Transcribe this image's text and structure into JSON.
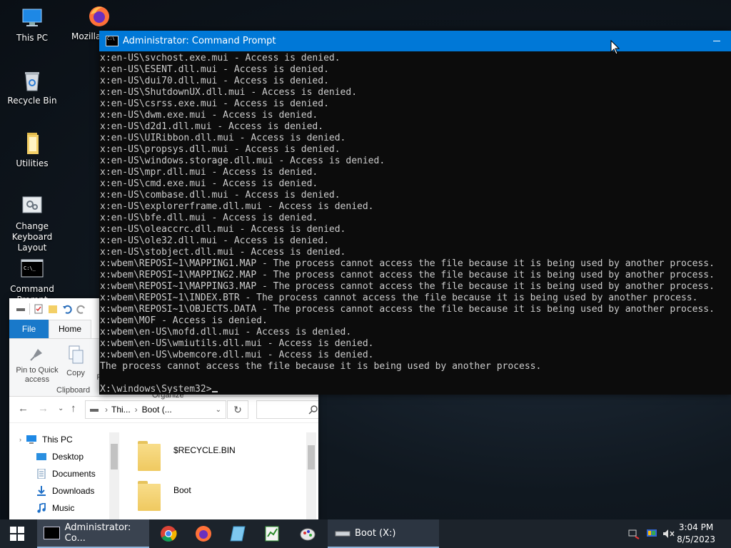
{
  "desktop": {
    "icons": [
      {
        "label": "This PC",
        "icon": "computer-icon"
      },
      {
        "label": "Mozilla",
        "icon": "firefox-icon"
      },
      {
        "label": "Recycle Bin",
        "icon": "recycle-bin-icon"
      },
      {
        "label": "Utilities",
        "icon": "folder-icon"
      },
      {
        "label": "Change Keyboard Layout",
        "icon": "keyboard-settings-icon"
      },
      {
        "label": "Command Prompt",
        "icon": "cmd-icon"
      }
    ]
  },
  "cmd": {
    "title": "Administrator: Command Prompt",
    "lines": [
      "x:en-US\\svchost.exe.mui - Access is denied.",
      "x:en-US\\ESENT.dll.mui - Access is denied.",
      "x:en-US\\dui70.dll.mui - Access is denied.",
      "x:en-US\\ShutdownUX.dll.mui - Access is denied.",
      "x:en-US\\csrss.exe.mui - Access is denied.",
      "x:en-US\\dwm.exe.mui - Access is denied.",
      "x:en-US\\d2d1.dll.mui - Access is denied.",
      "x:en-US\\UIRibbon.dll.mui - Access is denied.",
      "x:en-US\\propsys.dll.mui - Access is denied.",
      "x:en-US\\windows.storage.dll.mui - Access is denied.",
      "x:en-US\\mpr.dll.mui - Access is denied.",
      "x:en-US\\cmd.exe.mui - Access is denied.",
      "x:en-US\\combase.dll.mui - Access is denied.",
      "x:en-US\\explorerframe.dll.mui - Access is denied.",
      "x:en-US\\bfe.dll.mui - Access is denied.",
      "x:en-US\\oleaccrc.dll.mui - Access is denied.",
      "x:en-US\\ole32.dll.mui - Access is denied.",
      "x:en-US\\stobject.dll.mui - Access is denied.",
      "x:wbem\\REPOSI~1\\MAPPING1.MAP - The process cannot access the file because it is being used by another process.",
      "x:wbem\\REPOSI~1\\MAPPING2.MAP - The process cannot access the file because it is being used by another process.",
      "x:wbem\\REPOSI~1\\MAPPING3.MAP - The process cannot access the file because it is being used by another process.",
      "x:wbem\\REPOSI~1\\INDEX.BTR - The process cannot access the file because it is being used by another process.",
      "x:wbem\\REPOSI~1\\OBJECTS.DATA - The process cannot access the file because it is being used by another process.",
      "x:wbem\\MOF - Access is denied.",
      "x:wbem\\en-US\\mofd.dll.mui - Access is denied.",
      "x:wbem\\en-US\\wmiutils.dll.mui - Access is denied.",
      "x:wbem\\en-US\\wbemcore.dll.mui - Access is denied.",
      "The process cannot access the file because it is being used by another process."
    ],
    "prompt": "X:\\windows\\System32>"
  },
  "explorer": {
    "tabs": {
      "file": "File",
      "home": "Home"
    },
    "ribbon": {
      "pin_label": "Pin to Quick access",
      "copy_label": "Copy",
      "paste_partial": "P",
      "clipboard_group": "Clipboard",
      "organize_group": "Organize"
    },
    "address": {
      "seg1": "Thi...",
      "seg2": "Boot (..."
    },
    "nav_items": [
      {
        "label": "This PC",
        "icon": "computer-icon"
      },
      {
        "label": "Desktop",
        "icon": "desktop-folder-icon"
      },
      {
        "label": "Documents",
        "icon": "documents-icon"
      },
      {
        "label": "Downloads",
        "icon": "downloads-icon"
      },
      {
        "label": "Music",
        "icon": "music-icon"
      }
    ],
    "files": [
      {
        "name": "$RECYCLE.BIN"
      },
      {
        "name": "Boot"
      }
    ]
  },
  "taskbar": {
    "cmd_label": "Administrator: Co...",
    "explorer_label": "Boot (X:)",
    "clock_time": "3:04 PM",
    "clock_date": "8/5/2023"
  },
  "colors": {
    "titlebar": "#0078d7",
    "file_tab": "#1979ca",
    "taskbar": "#1c232b"
  }
}
